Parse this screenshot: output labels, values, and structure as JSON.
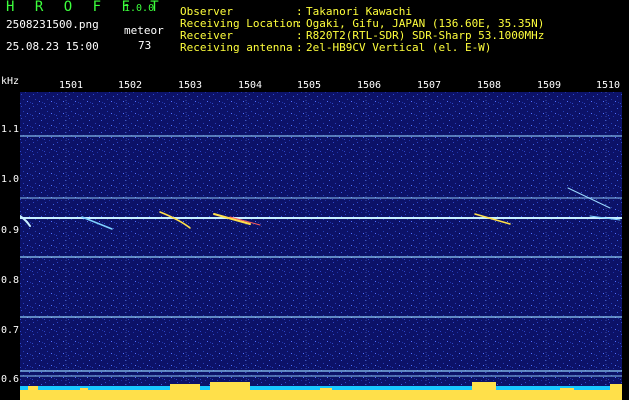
{
  "header": {
    "app_title": "H R O F F T",
    "app_version": "1.0.0",
    "file_name": "2508231500.png",
    "meteor_label": "meteor",
    "meteor_count": "73",
    "date_time": "25.08.23 15:00"
  },
  "info": [
    {
      "label": "Observer",
      "value": "Takanori Kawachi"
    },
    {
      "label": "Receiving Location",
      "value": "Ogaki, Gifu, JAPAN (136.60E, 35.35N)"
    },
    {
      "label": "Receiver",
      "value": "R820T2(RTL-SDR) SDR-Sharp 53.1000MHz"
    },
    {
      "label": "Receiving antenna",
      "value": "2el-HB9CV Vertical (el. E-W)"
    }
  ],
  "separator": ":",
  "axis": {
    "unit": "kHz",
    "freq_ticks": [
      "1.1",
      "1.0",
      "0.9",
      "0.8",
      "0.7",
      "0.6"
    ],
    "time_ticks": [
      "1501",
      "1502",
      "1503",
      "1504",
      "1505",
      "1506",
      "1507",
      "1508",
      "1509",
      "1510"
    ]
  },
  "colors": {
    "background": "#0c1268",
    "carrier": "#9ad8ff",
    "meteor": "#ffe04a",
    "signal_floor": "#19c8ff"
  }
}
